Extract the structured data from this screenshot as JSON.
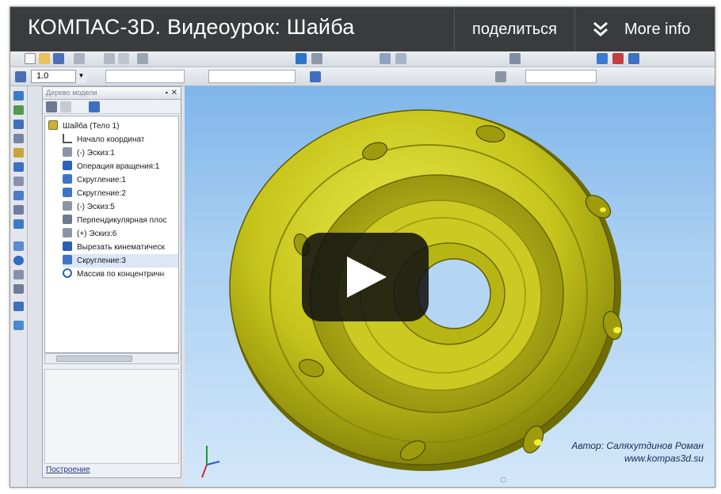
{
  "video": {
    "title": "КОМПАС-3D. Видеоурок: Шайба",
    "share_label": "поделиться",
    "more_info_label": "More info"
  },
  "toolbar": {
    "scale_value": "1.0"
  },
  "tree": {
    "panel_title": "Дерево модели",
    "items": [
      {
        "label": "Шайба (Тело 1)"
      },
      {
        "label": "Начало координат"
      },
      {
        "label": "(-) Эскиз:1"
      },
      {
        "label": "Операция вращения:1"
      },
      {
        "label": "Скругление:1"
      },
      {
        "label": "Скругление:2"
      },
      {
        "label": "(-) Эскиз:5"
      },
      {
        "label": "Перпендикулярная плос"
      },
      {
        "label": "(+) Эскиз:6"
      },
      {
        "label": "Вырезать кинематическ"
      },
      {
        "label": "Скругление:3"
      },
      {
        "label": "Массив по концентричн"
      }
    ],
    "bottom_tab": "Построение"
  },
  "viewport": {
    "author_line1": "Автор: Саляхутдинов Роман",
    "author_line2": "www.kompas3d.su",
    "part_color": "#c9c81a"
  },
  "colors": {
    "title_bar": "#161616",
    "sky_top": "#7fb6ea",
    "sky_bottom": "#d3e7f9"
  }
}
